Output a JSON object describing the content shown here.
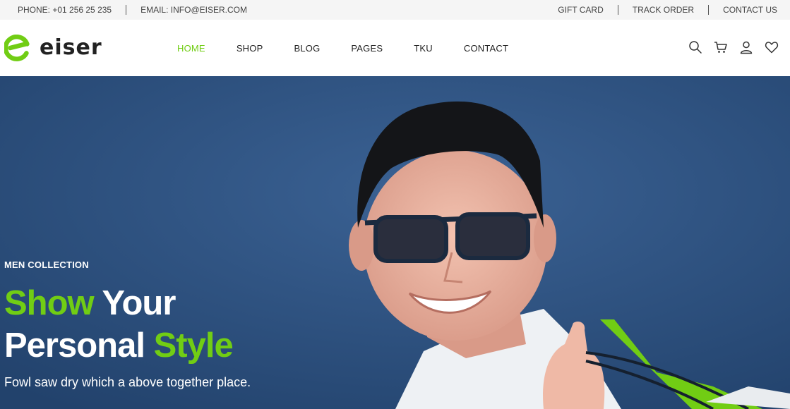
{
  "topbar": {
    "phone": "PHONE: +01 256 25 235",
    "email": "EMAIL: INFO@EISER.COM",
    "links": [
      "GIFT CARD",
      "TRACK ORDER",
      "CONTACT US"
    ]
  },
  "header": {
    "logo_text": "eiser",
    "nav": [
      "HOME",
      "SHOP",
      "BLOG",
      "PAGES",
      "TKU",
      "CONTACT"
    ],
    "active_nav": "HOME",
    "icons": [
      "search-icon",
      "cart-icon",
      "user-icon",
      "heart-icon"
    ]
  },
  "hero": {
    "subtitle": "MEN COLLECTION",
    "title_word1": "Show",
    "title_word2": "Your",
    "title_word3": "Personal",
    "title_word4": "Style",
    "description": "Fowl saw dry which a above together place."
  },
  "colors": {
    "accent": "#71cd14",
    "hero_bg": "#2f5585",
    "topbar_bg": "#f5f5f5"
  }
}
